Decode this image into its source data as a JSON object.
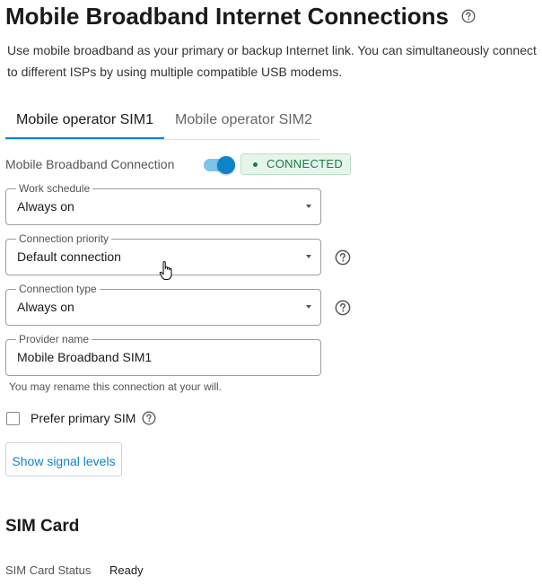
{
  "header": {
    "title": "Mobile Broadband Internet Connections",
    "help_icon": "question-circle-icon",
    "description_line1": "Use mobile broadband as your primary or backup Internet link. You can simultaneously connect",
    "description_line2": "to different ISPs by using multiple compatible USB modems."
  },
  "tabs": [
    {
      "label": "Mobile operator SIM1",
      "active": true
    },
    {
      "label": "Mobile operator SIM2",
      "active": false
    }
  ],
  "connection": {
    "label": "Mobile Broadband Connection",
    "toggle_on": true,
    "status": "CONNECTED",
    "status_color": "#1b7a45"
  },
  "fields": {
    "work_schedule": {
      "label": "Work schedule",
      "value": "Always on"
    },
    "connection_priority": {
      "label": "Connection priority",
      "value": "Default connection"
    },
    "connection_type": {
      "label": "Connection type",
      "value": "Always on"
    },
    "provider_name": {
      "label": "Provider name",
      "value": "Mobile Broadband SIM1",
      "hint": "You may rename this connection at your will."
    }
  },
  "prefer_primary_sim": {
    "label": "Prefer primary SIM",
    "checked": false
  },
  "buttons": {
    "show_signal_levels": "Show signal levels"
  },
  "sim_card": {
    "heading": "SIM Card",
    "status_label": "SIM Card Status",
    "status_value": "Ready"
  },
  "colors": {
    "accent": "#0d84c9",
    "badge_bg": "#e5f5eb"
  }
}
